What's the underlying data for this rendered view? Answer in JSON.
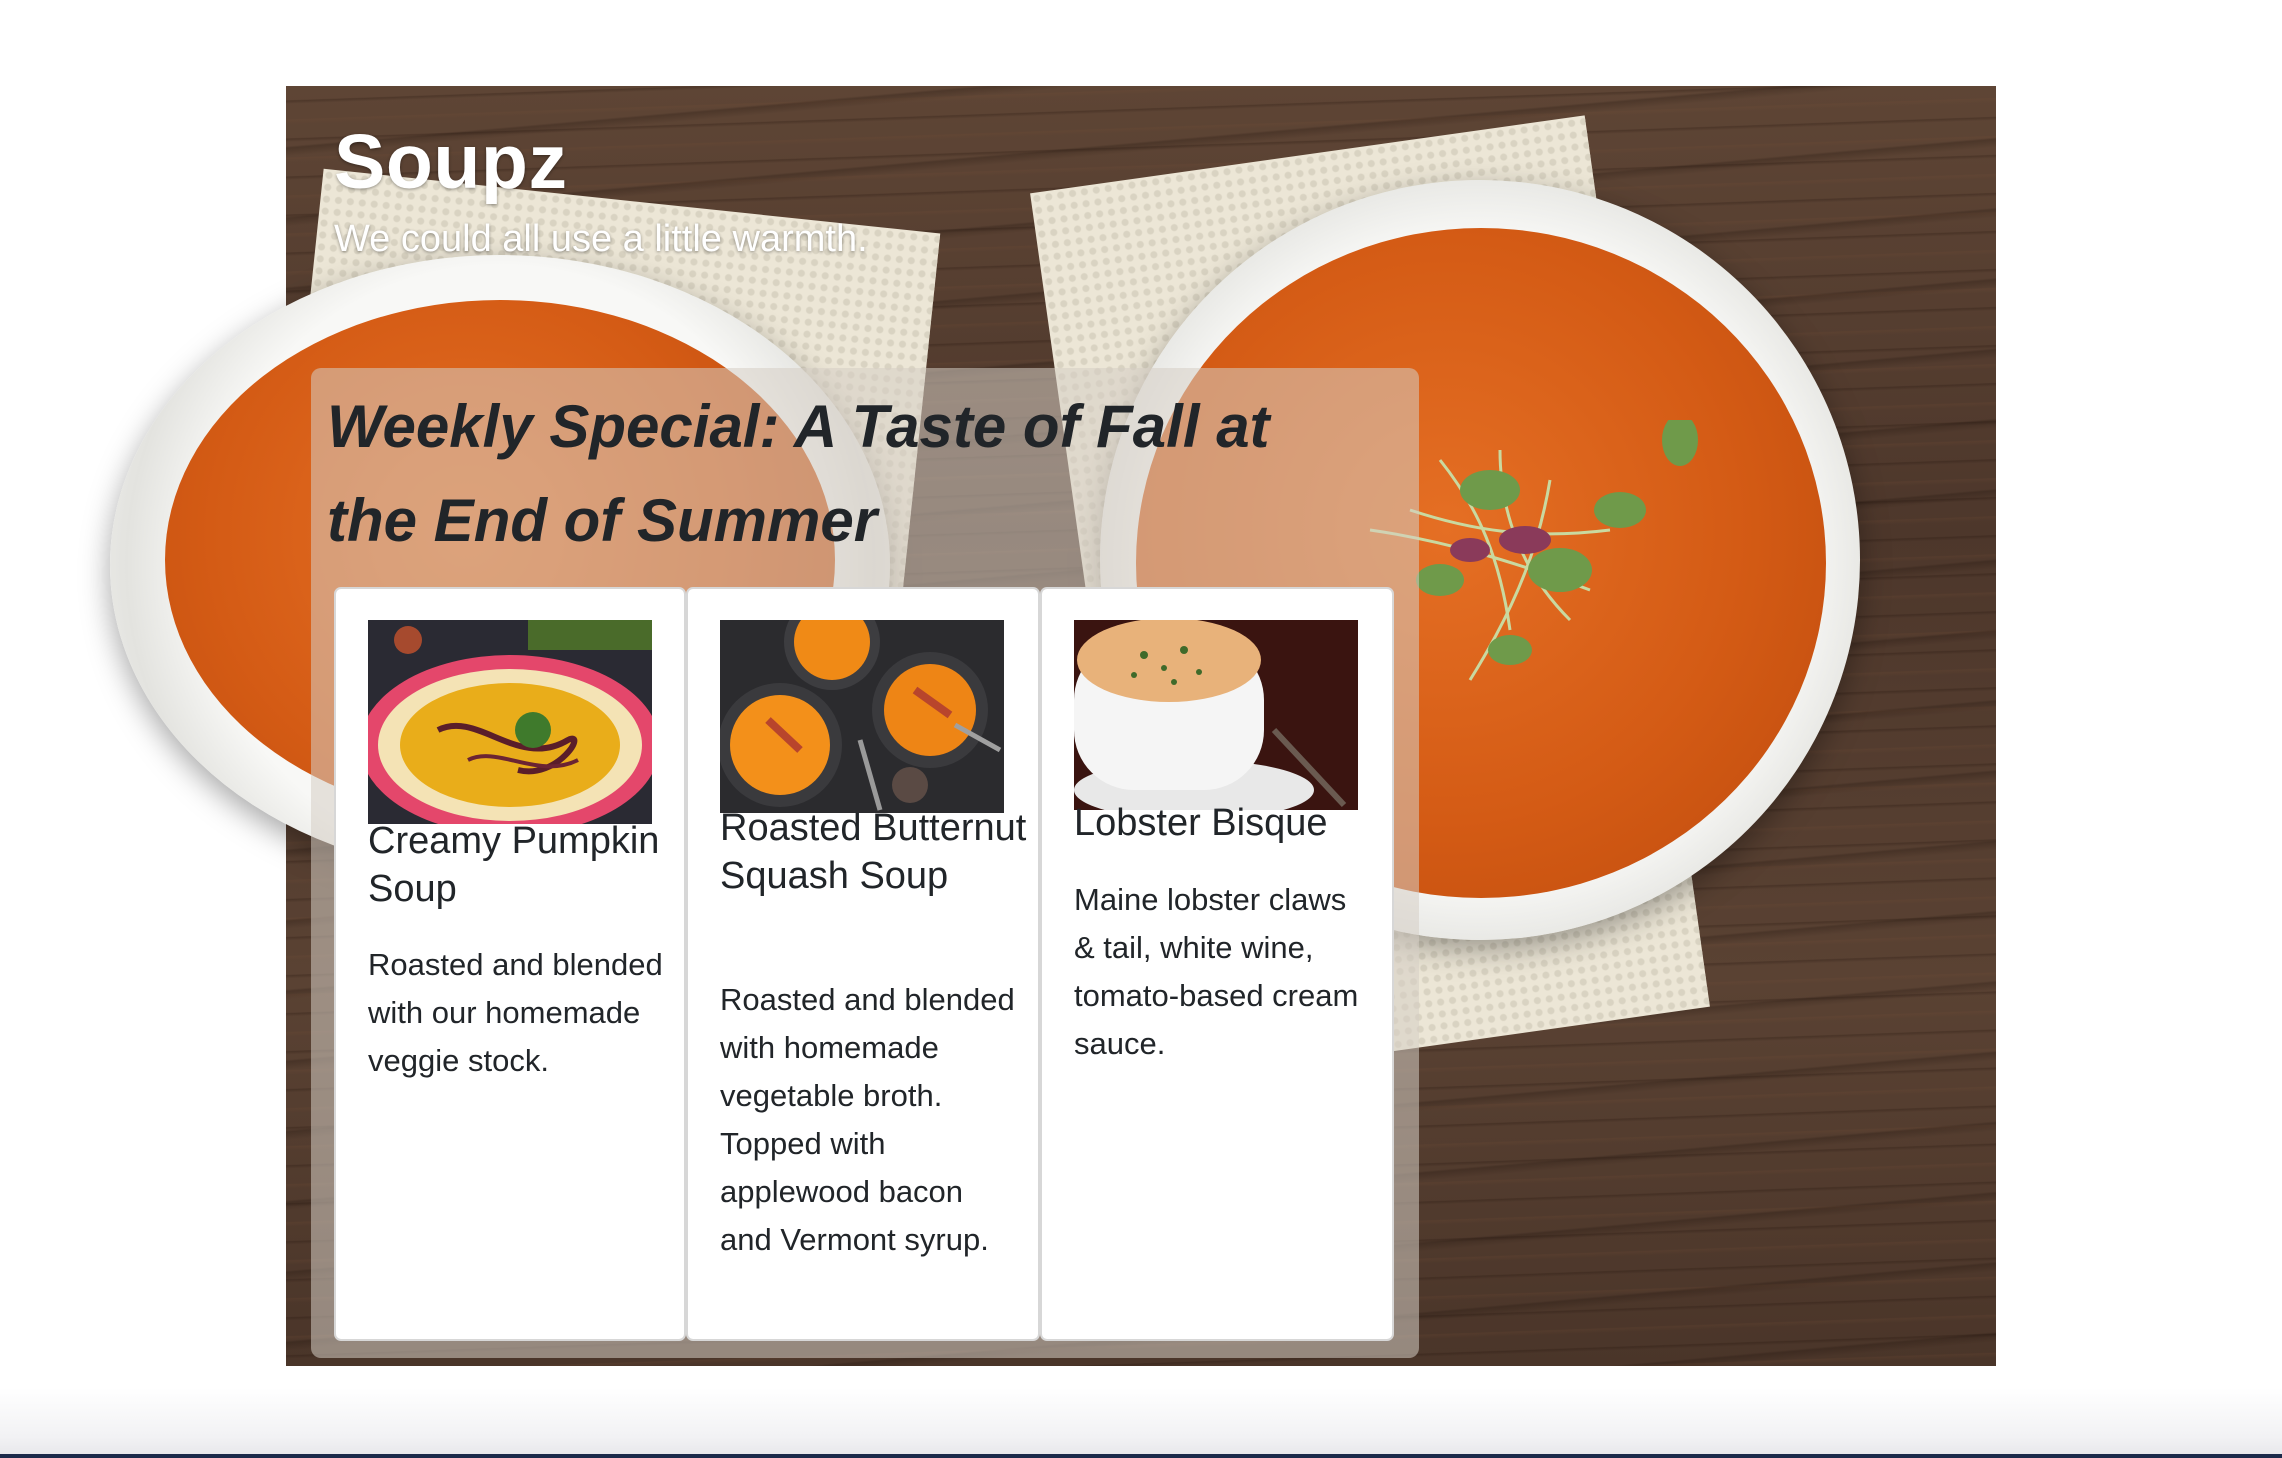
{
  "site": {
    "title": "Soupz",
    "tagline": "We could all use a little warmth."
  },
  "special": {
    "heading": "Weekly Special: A Taste of Fall at the End of Summer"
  },
  "cards": [
    {
      "title": "Creamy Pumpkin Soup",
      "text": "Roasted and blended with our homemade veggie stock."
    },
    {
      "title": "Roasted Butternut Squash Soup",
      "text": "Roasted and blended with homemade vegetable broth. Topped with applewood bacon and Vermont syrup."
    },
    {
      "title": "Lobster Bisque",
      "text": "Maine lobster claws & tail, white wine, tomato-based cream sauce."
    }
  ],
  "colors": {
    "text_dark": "#212529",
    "soup_orange": "#d45b15",
    "wood_brown": "#4d372b"
  }
}
